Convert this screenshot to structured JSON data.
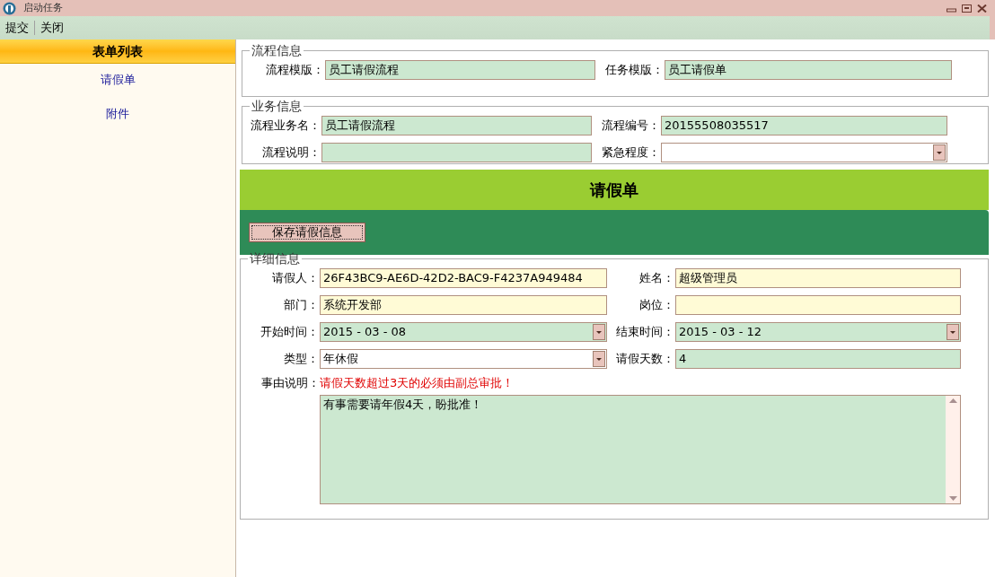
{
  "window": {
    "title": "启动任务"
  },
  "menu": [
    {
      "label": "提交"
    },
    {
      "label": "关闭"
    }
  ],
  "sidebar": {
    "title": "表单列表",
    "items": [
      {
        "label": "请假单"
      },
      {
        "label": "附件"
      }
    ]
  },
  "process_info": {
    "legend": "流程信息",
    "fields": [
      {
        "label": "流程模版：",
        "value": "员工请假流程",
        "kind": "text",
        "readonly": true
      },
      {
        "label": "任务模版：",
        "value": "员工请假单",
        "kind": "text",
        "readonly": true
      }
    ]
  },
  "business_info": {
    "legend": "业务信息",
    "fields": [
      {
        "label": "流程业务名：",
        "value": "员工请假流程",
        "kind": "text",
        "readonly": true
      },
      {
        "label": "流程编号：",
        "value": "20155508035517",
        "kind": "text",
        "readonly": true
      },
      {
        "label": "流程说明：",
        "kind": "text",
        "readonly": true
      },
      {
        "label": "紧急程度：",
        "kind": "dropdown",
        "readonly": false
      }
    ]
  },
  "form_title": "请假单",
  "toolbar": {
    "button": "保存请假信息"
  },
  "details": {
    "legend": "详细信息",
    "fields": [
      {
        "label": "请假人：",
        "value": "26F43BC9-AE6D-42D2-BAC9-F4237A949484",
        "kind": "text",
        "readonly": false
      },
      {
        "label": "姓名：",
        "value": "超级管理员",
        "kind": "text",
        "readonly": false
      },
      {
        "label": "部门：",
        "value": "系统开发部",
        "kind": "text",
        "readonly": false
      },
      {
        "label": "岗位：",
        "kind": "text",
        "readonly": false
      },
      {
        "label": "开始时间：",
        "value": "2015 - 03 - 08",
        "kind": "dropdown",
        "readonly": true
      },
      {
        "label": "结束时间：",
        "value": "2015 - 03 - 12",
        "kind": "dropdown",
        "readonly": true
      },
      {
        "label": "类型：",
        "value": "年休假",
        "kind": "dropdown",
        "readonly": false
      },
      {
        "label": "请假天数：",
        "value": "4",
        "kind": "text",
        "readonly": true
      }
    ],
    "reason": {
      "label": "事由说明：",
      "note": "请假天数超过3天的必须由副总审批！",
      "value": "有事需要请年假4天，盼批准！"
    }
  }
}
